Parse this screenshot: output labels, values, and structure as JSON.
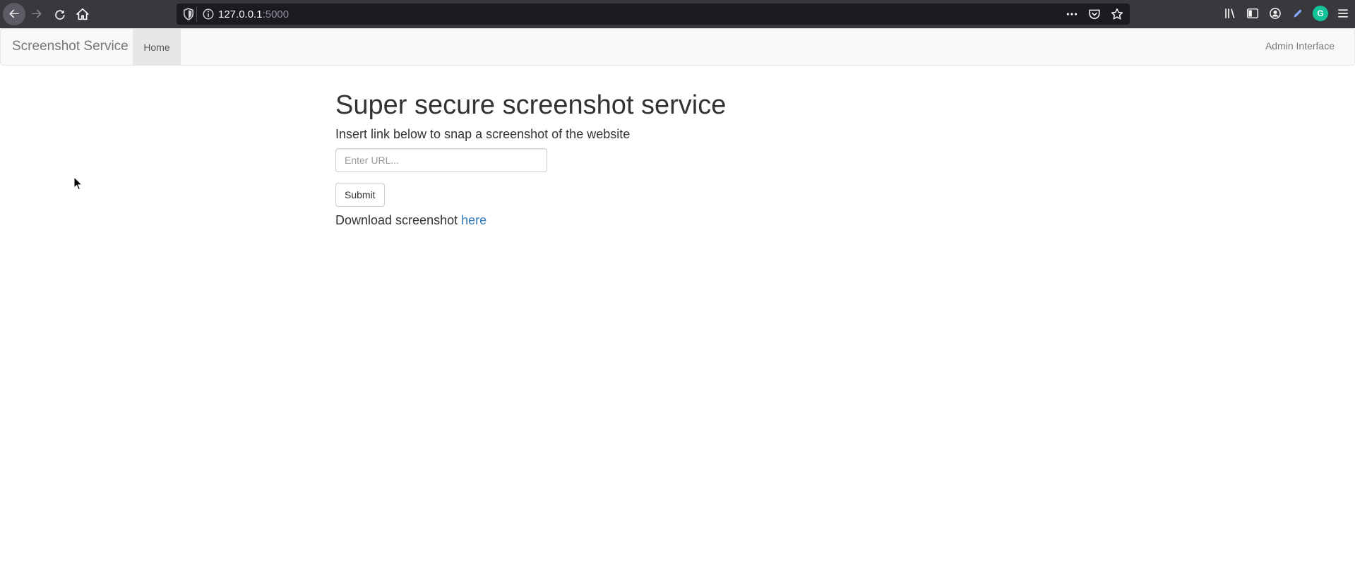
{
  "browser": {
    "url_host": "127.0.0.1",
    "url_port": ":5000"
  },
  "navbar": {
    "brand": "Screenshot Service",
    "home_label": "Home",
    "admin_label": "Admin Interface"
  },
  "main": {
    "title": "Super secure screenshot service",
    "subtitle": "Insert link below to snap a screenshot of the website",
    "url_placeholder": "Enter URL...",
    "submit_label": "Submit",
    "download_text": "Download screenshot ",
    "download_link": "here"
  },
  "colors": {
    "link": "#337ab7",
    "navbar_bg": "#f8f8f8",
    "active_tab_bg": "#e7e7e7",
    "chrome_bg": "#38383d",
    "grammarly": "#15c39a"
  }
}
